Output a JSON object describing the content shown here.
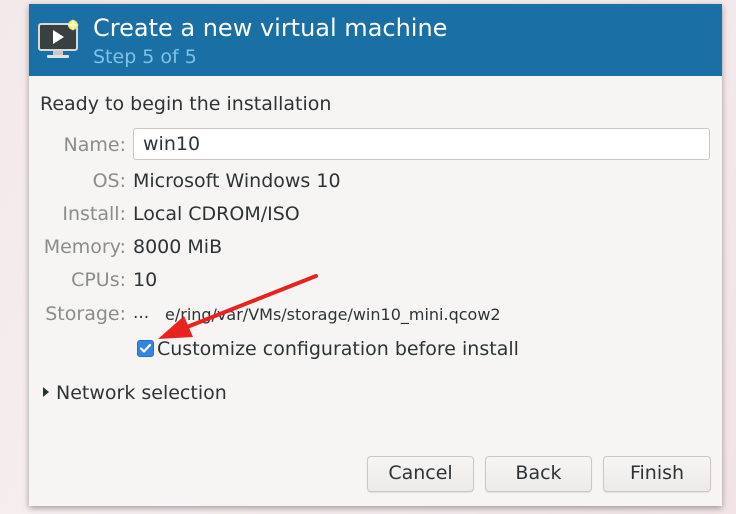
{
  "header": {
    "title": "Create a new virtual machine",
    "step": "Step 5 of 5",
    "icon": "vm-monitor-icon"
  },
  "heading": "Ready to begin the installation",
  "fields": {
    "name": {
      "label": "Name:",
      "value": "win10"
    },
    "os": {
      "label": "OS:",
      "value": "Microsoft Windows 10"
    },
    "install": {
      "label": "Install:",
      "value": "Local CDROM/ISO"
    },
    "memory": {
      "label": "Memory:",
      "value": "8000 MiB"
    },
    "cpus": {
      "label": "CPUs:",
      "value": "10"
    },
    "storage": {
      "label": "Storage:",
      "dots": "...",
      "value": "e/ring/var/VMs/storage/win10_mini.qcow2"
    }
  },
  "customize": {
    "label": "Customize configuration before install",
    "checked": true
  },
  "network": {
    "label": "Network selection"
  },
  "buttons": {
    "cancel": "Cancel",
    "back": "Back",
    "finish": "Finish"
  },
  "colors": {
    "header_bg": "#1a70a4",
    "step_text": "#7ec2e8",
    "checkbox": "#3584e4",
    "annotation_arrow": "#e8231f"
  }
}
